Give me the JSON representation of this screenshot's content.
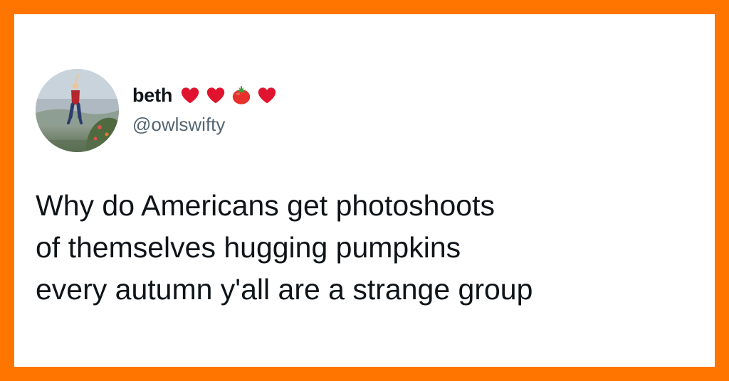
{
  "frame": {
    "border_color": "#FF7500",
    "background": "#FFFFFF"
  },
  "author": {
    "display_name": "beth",
    "handle": "@owlswifty",
    "name_emojis": [
      "red-heart-icon",
      "red-heart-icon",
      "tomato-icon",
      "red-heart-icon"
    ],
    "avatar_icon": "profile-photo"
  },
  "tweet": {
    "lines": [
      "Why do Americans get photoshoots",
      "of themselves hugging pumpkins",
      "every autumn y'all are a strange group"
    ],
    "text_color": "#0F1419",
    "handle_color": "#536471"
  },
  "colors": {
    "heart": "#E0142E",
    "tomato": "#E8312B",
    "tomato_leaf": "#3FA33A"
  }
}
